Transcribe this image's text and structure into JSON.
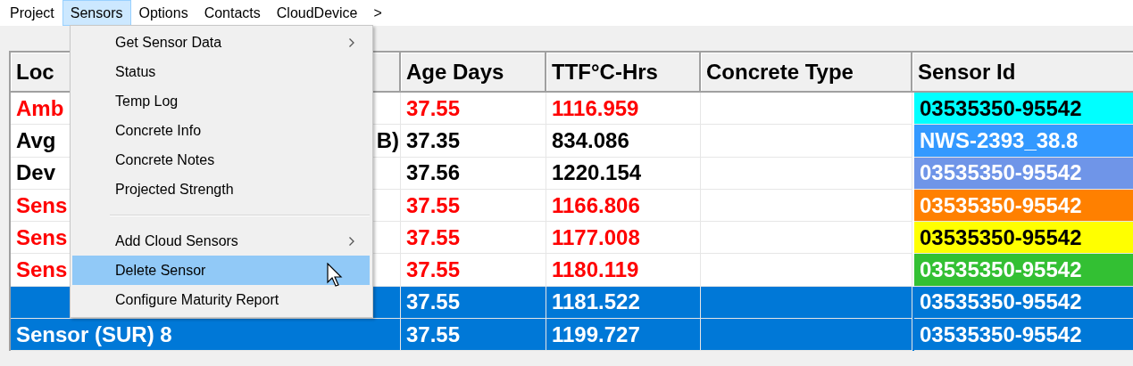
{
  "menu_bar": [
    {
      "label": "Project",
      "selected": false
    },
    {
      "label": "Sensors",
      "selected": true
    },
    {
      "label": "Options",
      "selected": false
    },
    {
      "label": "Contacts",
      "selected": false
    },
    {
      "label": "CloudDevice",
      "selected": false
    },
    {
      "label": ">",
      "selected": false
    }
  ],
  "table": {
    "columns": [
      "Loc",
      "Age Days",
      "TTF°C-Hrs",
      "Concrete Type",
      "Sensor Id"
    ],
    "rows": [
      {
        "location": "Amb",
        "age_days": "37.55",
        "ttf": "1116.959",
        "color": "#ff0000",
        "selected": false,
        "sensor_id": {
          "text": "03535350-95542",
          "color": "#00ffff"
        }
      },
      {
        "location": "Avg",
        "location_tail": "B)",
        "age_days": "37.35",
        "ttf": "834.086",
        "color": "#000000",
        "selected": false,
        "sensor_id": {
          "text": "NWS-2393_38.8",
          "color": "#3399ff"
        }
      },
      {
        "location": "Dev",
        "age_days": "37.56",
        "ttf": "1220.154",
        "color": "#000000",
        "selected": false,
        "sensor_id": {
          "text": "03535350-95542",
          "color": "#6f95e8"
        }
      },
      {
        "location": "Sens",
        "age_days": "37.55",
        "ttf": "1166.806",
        "color": "#ff0000",
        "selected": false,
        "sensor_id": {
          "text": "03535350-95542",
          "color": "#ff8000"
        }
      },
      {
        "location": "Sens",
        "age_days": "37.55",
        "ttf": "1177.008",
        "color": "#ff0000",
        "selected": false,
        "sensor_id": {
          "text": "03535350-95542",
          "color": "#ffff00"
        }
      },
      {
        "location": "Sens",
        "age_days": "37.55",
        "ttf": "1180.119",
        "color": "#ff0000",
        "selected": false,
        "sensor_id": {
          "text": "03535350-95542",
          "color": "#33c033"
        }
      },
      {
        "age_days": "37.55",
        "ttf": "1181.522",
        "color": "#ffffff",
        "selected": true,
        "sensor_id": {
          "text": "03535350-95542",
          "color": "#0078d7"
        }
      },
      {
        "location": "Sensor (SUR) 8",
        "age_days": "37.55",
        "ttf": "1199.727",
        "color": "#ffffff",
        "selected": true,
        "sensor_id": {
          "text": "03535350-95542",
          "color": "#0078d7"
        }
      }
    ]
  },
  "sensors_menu": [
    {
      "kind": "item",
      "label": "Get Sensor Data",
      "submenu": true,
      "selected": false
    },
    {
      "kind": "item",
      "label": "Status",
      "submenu": false,
      "selected": false
    },
    {
      "kind": "item",
      "label": "Temp Log",
      "submenu": false,
      "selected": false
    },
    {
      "kind": "item",
      "label": "Concrete Info",
      "submenu": false,
      "selected": false
    },
    {
      "kind": "item",
      "label": "Concrete Notes",
      "submenu": false,
      "selected": false
    },
    {
      "kind": "item",
      "label": "Projected Strength",
      "submenu": false,
      "selected": false
    },
    {
      "kind": "separator"
    },
    {
      "kind": "item",
      "label": "Add Cloud Sensors",
      "submenu": true,
      "selected": false
    },
    {
      "kind": "item",
      "label": "Delete Sensor",
      "submenu": false,
      "selected": true
    },
    {
      "kind": "item",
      "label": "Configure Maturity Report",
      "submenu": false,
      "selected": false
    }
  ]
}
